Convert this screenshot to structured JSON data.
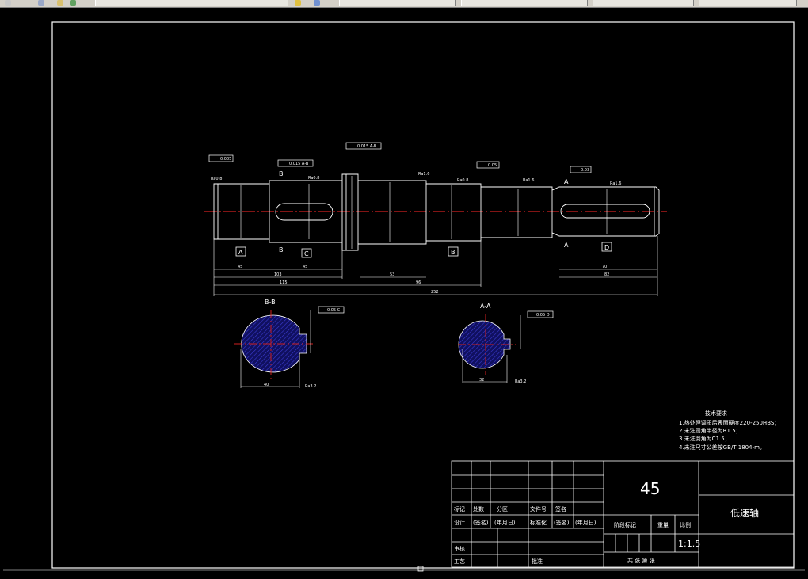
{
  "toolbar": {
    "icons": [
      "toolbar-icon-1",
      "toolbar-icon-2",
      "toolbar-icon-3",
      "toolbar-icon-4",
      "toolbar-icon-5",
      "toolbar-icon-6"
    ],
    "tabs": [
      "",
      "",
      "",
      "",
      "",
      ""
    ]
  },
  "drawing": {
    "section_bb": "B-B",
    "section_aa": "A-A",
    "markers": {
      "A": "A",
      "B": "B",
      "C": "C",
      "D": "D"
    },
    "dims_bottom": {
      "d45": "45",
      "d103": "103",
      "d45b": "45",
      "d115": "115",
      "d53": "53",
      "d96": "96",
      "d252": "252",
      "d70": "70",
      "d82": "82"
    },
    "tolerances": {
      "t1": "0.005",
      "t2": "0.015 A-B",
      "t3": "0.015 A-B",
      "t4": "0.05",
      "t5": "0.03",
      "t6": "0.05 C",
      "t7": "0.05 D"
    },
    "roughness": {
      "r1": "Ra0.8",
      "r2": "Ra0.8",
      "r3": "Ra1.6",
      "r4": "Ra0.8",
      "r5": "Ra1.6",
      "r6": "Ra1.6",
      "r7": "Ra3.2",
      "r8": "Ra3.2"
    },
    "section_dims": {
      "bb_width": "40",
      "aa_width": "32"
    }
  },
  "tech_requirements": {
    "title": "技术要求",
    "items": [
      "1.热处理调质后表面硬度220-250HBS；",
      "2.未注圆角半径为R1.5；",
      "3.未注倒角为C1.5；",
      "4.未注尺寸公差按GB/T 1804-m。"
    ]
  },
  "title_block": {
    "material": "45",
    "part_name": "低速轴",
    "scale": "1:1.5",
    "row_marks": [
      "标记",
      "处数",
      "分区",
      "文件号",
      "签名"
    ],
    "row_design": [
      "设计",
      "(签名)",
      "(年月日)",
      "标准化",
      "(签名)",
      "(年月日)"
    ],
    "stage_label": "阶段标记",
    "weight_label": "重量",
    "scale_label": "比例",
    "review": "审核",
    "process": "工艺",
    "approve": "批准",
    "sheets": "共  张  第  张"
  }
}
